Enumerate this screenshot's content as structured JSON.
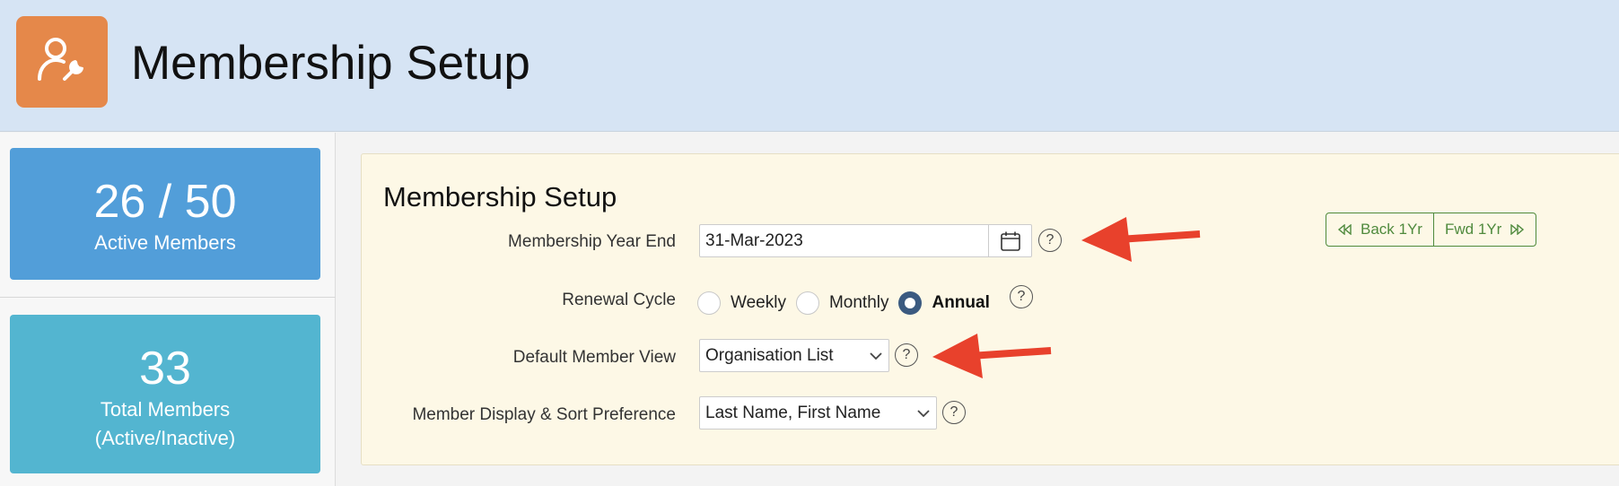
{
  "header": {
    "title": "Membership Setup",
    "icon": "member-settings-icon",
    "icon_bg": "#e5884a"
  },
  "stats": {
    "active": {
      "value": "26 / 50",
      "label": "Active Members",
      "color": "#529ed9"
    },
    "total": {
      "value": "33",
      "label_line1": "Total Members",
      "label_line2": "(Active/Inactive)",
      "color": "#53b5d0"
    }
  },
  "panel": {
    "title": "Membership Setup",
    "fields": {
      "year_end": {
        "label": "Membership Year End",
        "value": "31-Mar-2023"
      },
      "renewal": {
        "label": "Renewal Cycle",
        "options": [
          "Weekly",
          "Monthly",
          "Annual"
        ],
        "selected": "Annual"
      },
      "default_view": {
        "label": "Default Member View",
        "value": "Organisation List"
      },
      "display_sort": {
        "label": "Member Display & Sort Preference",
        "value": "Last Name, First Name"
      }
    },
    "help_glyph": "?",
    "nav": {
      "back_label": "Back 1Yr",
      "fwd_label": "Fwd 1Yr",
      "color": "#4f8a3d"
    }
  },
  "annotations": {
    "arrow_color": "#e8412c"
  }
}
